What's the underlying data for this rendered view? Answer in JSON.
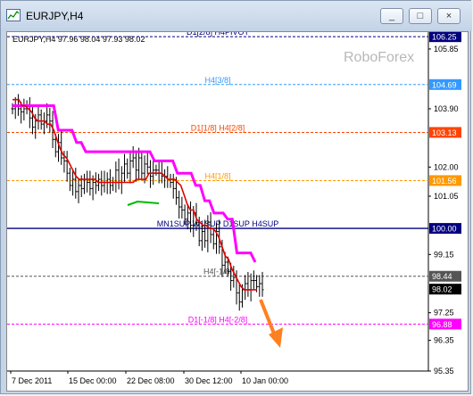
{
  "window": {
    "title": "EURJPY,H4",
    "minimize": "_",
    "maximize": "□",
    "close": "×"
  },
  "symbol_info": "EURJPY,H4  97.96 98.04 97.93 98.02",
  "watermark": "RoboForex",
  "colors": {
    "price_bars": "#000000",
    "fast_line": "#e00000",
    "slow_line": "#ff00ff",
    "trend_up": "#00bb00",
    "arrow": "#ff8020"
  },
  "chart_data": {
    "type": "line",
    "title": "EURJPY,H4",
    "ylim": [
      95.35,
      106.4
    ],
    "price_ticks": [
      "106.25",
      "105.85",
      "104.69",
      "103.90",
      "103.13",
      "102.00",
      "101.56",
      "101.05",
      "100.00",
      "99.15",
      "98.44",
      "98.02",
      "97.25",
      "96.88",
      "96.35",
      "95.35"
    ],
    "date_ticks": [
      "7 Dec 2011",
      "15 Dec 00:00",
      "22 Dec 08:00",
      "30 Dec 12:00",
      "10 Jan 00:00"
    ],
    "levels": [
      {
        "label": "D1[2/8] H4PIVOT",
        "value": 106.25,
        "color": "#000080",
        "dash": true,
        "badge": true
      },
      {
        "label": "H4[3/8]",
        "value": 104.69,
        "color": "#3399ff",
        "dash": true,
        "badge": true
      },
      {
        "label": "D1[1/8] H4[2/8]",
        "value": 103.13,
        "color": "#ff4400",
        "dash": true,
        "badge": true
      },
      {
        "label": "H4[1/8]",
        "value": 101.56,
        "color": "#ff9900",
        "dash": true,
        "badge": true
      },
      {
        "label": "MN1SUP W1SUP D1SUP H4SUP",
        "value": 100.0,
        "color": "#000080",
        "dash": false,
        "badge": true
      },
      {
        "label": "H4[-1/8]",
        "value": 98.44,
        "color": "#555555",
        "dash": true,
        "badge": true
      },
      {
        "label": "D1[-1/8] H4[-2/8]",
        "value": 96.88,
        "color": "#ff00ff",
        "dash": true,
        "badge": true
      }
    ],
    "current_price": "98.02",
    "current_price_value": 98.02,
    "close_series": [
      103.9,
      104.0,
      103.9,
      103.8,
      103.9,
      104.0,
      103.6,
      103.3,
      103.5,
      103.7,
      103.4,
      103.5,
      103.7,
      103.5,
      102.9,
      102.5,
      102.8,
      102.3,
      102.2,
      101.8,
      101.4,
      101.6,
      101.2,
      101.4,
      101.3,
      101.6,
      101.5,
      101.3,
      101.5,
      101.4,
      101.6,
      101.4,
      101.5,
      101.6,
      101.4,
      101.5,
      101.9,
      101.5,
      101.8,
      102.1,
      101.8,
      102.2,
      102.3,
      101.9,
      102.3,
      101.8,
      102.1,
      102.0,
      101.7,
      101.9,
      101.9,
      101.8,
      101.7,
      101.7,
      101.6,
      101.5,
      101.3,
      101.0,
      100.7,
      100.6,
      100.3,
      100.5,
      100.1,
      100.5,
      100.2,
      99.6,
      99.9,
      99.6,
      100.2,
      99.8,
      99.5,
      99.9,
      99.4,
      98.8,
      98.9,
      98.6,
      98.3,
      98.4,
      97.9,
      97.6,
      98.0,
      98.2,
      98.0,
      98.3,
      98.3,
      98.1,
      98.2,
      98.0
    ],
    "fast_series": [
      104.2,
      104.2,
      104.2,
      104.0,
      104.0,
      103.9,
      103.8,
      103.6,
      103.5,
      103.5,
      103.5,
      103.4,
      103.4,
      103.2,
      102.9,
      102.6,
      102.4,
      102.3,
      102.1,
      101.9,
      101.7,
      101.6,
      101.6,
      101.6,
      101.6,
      101.6,
      101.6,
      101.5,
      101.5,
      101.5,
      101.5,
      101.5,
      101.5,
      101.5,
      101.5,
      101.5,
      101.5,
      101.5,
      101.5,
      101.6,
      101.6,
      101.6,
      101.6,
      101.8,
      101.8,
      101.8,
      101.8,
      101.8,
      101.7,
      101.6,
      101.6,
      101.6,
      101.5,
      101.4,
      101.1,
      100.8,
      100.6,
      100.6,
      100.3,
      100.2,
      100.1,
      100.1,
      100.0,
      100.0,
      99.9,
      99.7,
      99.4,
      99.1,
      99.0,
      98.7,
      98.5,
      98.3,
      98.1,
      98.0,
      98.0,
      98.0,
      98.0,
      98.0
    ],
    "slow_series": [
      104.0,
      104.0,
      104.0,
      104.0,
      104.0,
      104.0,
      104.0,
      104.0,
      104.0,
      104.0,
      103.2,
      103.2,
      103.2,
      103.2,
      102.8,
      102.8,
      102.5,
      102.5,
      102.5,
      102.5,
      102.5,
      102.5,
      102.5,
      102.5,
      102.5,
      102.5,
      102.5,
      102.5,
      102.5,
      102.5,
      102.5,
      102.2,
      102.2,
      102.2,
      102.2,
      102.2,
      101.8,
      101.8,
      101.8,
      101.8,
      101.4,
      101.4,
      100.9,
      100.9,
      100.5,
      100.5,
      100.5,
      100.3,
      100.3,
      99.2,
      99.2,
      99.2,
      99.2,
      98.9
    ]
  }
}
